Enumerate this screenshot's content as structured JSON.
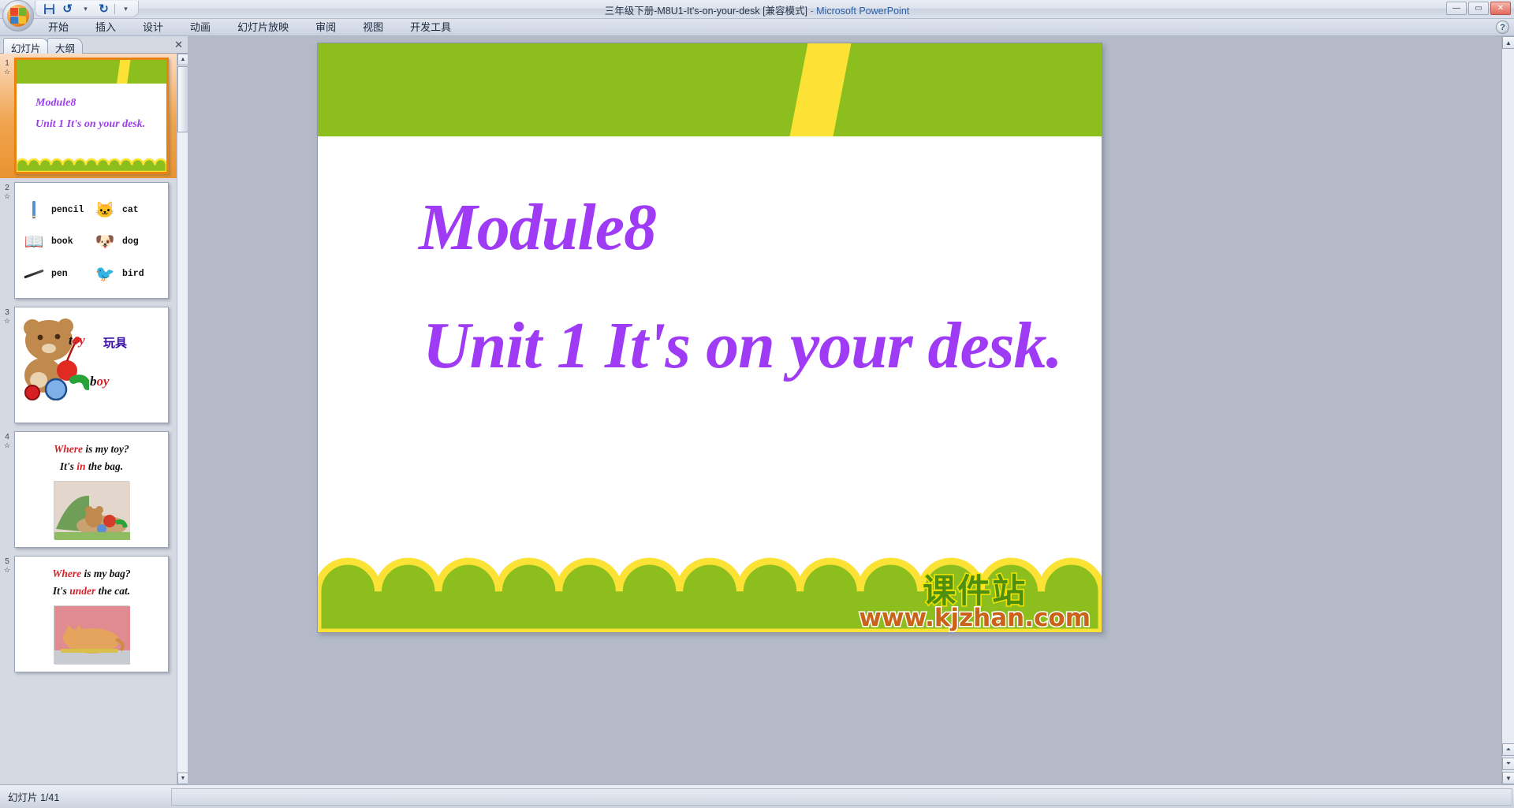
{
  "window": {
    "title_doc": "三年级下册-M8U1-It's-on-your-desk [兼容模式]",
    "title_sep": " - ",
    "title_app": "Microsoft PowerPoint",
    "minimize": "—",
    "maximize": "▭",
    "close": "✕",
    "help": "?"
  },
  "quick_access": {
    "save": "save-icon",
    "undo": "↺",
    "undo_dropdown": "▾",
    "redo": "↻",
    "customize": "▾"
  },
  "ribbon": {
    "tabs": [
      {
        "label": "开始"
      },
      {
        "label": "插入"
      },
      {
        "label": "设计"
      },
      {
        "label": "动画"
      },
      {
        "label": "幻灯片放映"
      },
      {
        "label": "审阅"
      },
      {
        "label": "视图"
      },
      {
        "label": "开发工具"
      }
    ]
  },
  "left_pane": {
    "tabs": [
      {
        "label": "幻灯片",
        "active": true
      },
      {
        "label": "大纲",
        "active": false
      }
    ],
    "close_label": "✕",
    "slides": [
      {
        "number": "1",
        "selected": true,
        "kind": "title",
        "line1": "Module8",
        "line2": "Unit 1   It's on your desk."
      },
      {
        "number": "2",
        "selected": false,
        "kind": "vocab",
        "items": [
          {
            "icon": "pencil-icon",
            "word": "pencil"
          },
          {
            "icon": "cat-icon",
            "word": "cat",
            "glyph": "🐱"
          },
          {
            "icon": "book-icon",
            "word": "book",
            "glyph": "📖"
          },
          {
            "icon": "dog-icon",
            "word": "dog",
            "glyph": "🐶"
          },
          {
            "icon": "pen-icon",
            "word": "pen"
          },
          {
            "icon": "bird-icon",
            "word": "bird",
            "glyph": "🐦"
          }
        ]
      },
      {
        "number": "3",
        "selected": false,
        "kind": "toy",
        "word_en_1": "toy",
        "word_cn_1": "玩具",
        "word_en_2": "boy"
      },
      {
        "number": "4",
        "selected": false,
        "kind": "sentence",
        "line1_hl": "Where",
        "line1_rest": " is my toy?",
        "line2_pre": "It's ",
        "line2_hl": "in",
        "line2_post": " the bag."
      },
      {
        "number": "5",
        "selected": false,
        "kind": "sentence",
        "line1_hl": "Where",
        "line1_rest": " is my bag?",
        "line2_pre": "It's ",
        "line2_hl": "under",
        "line2_post": " the cat."
      }
    ],
    "star_glyph": "☆",
    "scroll_up": "▲",
    "scroll_down": "▼"
  },
  "slide": {
    "title_line1": "Module8",
    "title_line2": "Unit 1   It's on your desk.",
    "colors": {
      "green": "#8cbe1e",
      "yellow": "#fce234",
      "title_purple": "#a03bf5"
    },
    "scallop_count": 13
  },
  "watermark": {
    "chinese": "课件站",
    "url": "www.kjzhan.com"
  },
  "stage_scroll": {
    "up": "▲",
    "down": "▼",
    "prev_slide": "⏶",
    "next_slide": "⏷"
  },
  "status_bar": {
    "slide_counter": "幻灯片 1/41"
  }
}
